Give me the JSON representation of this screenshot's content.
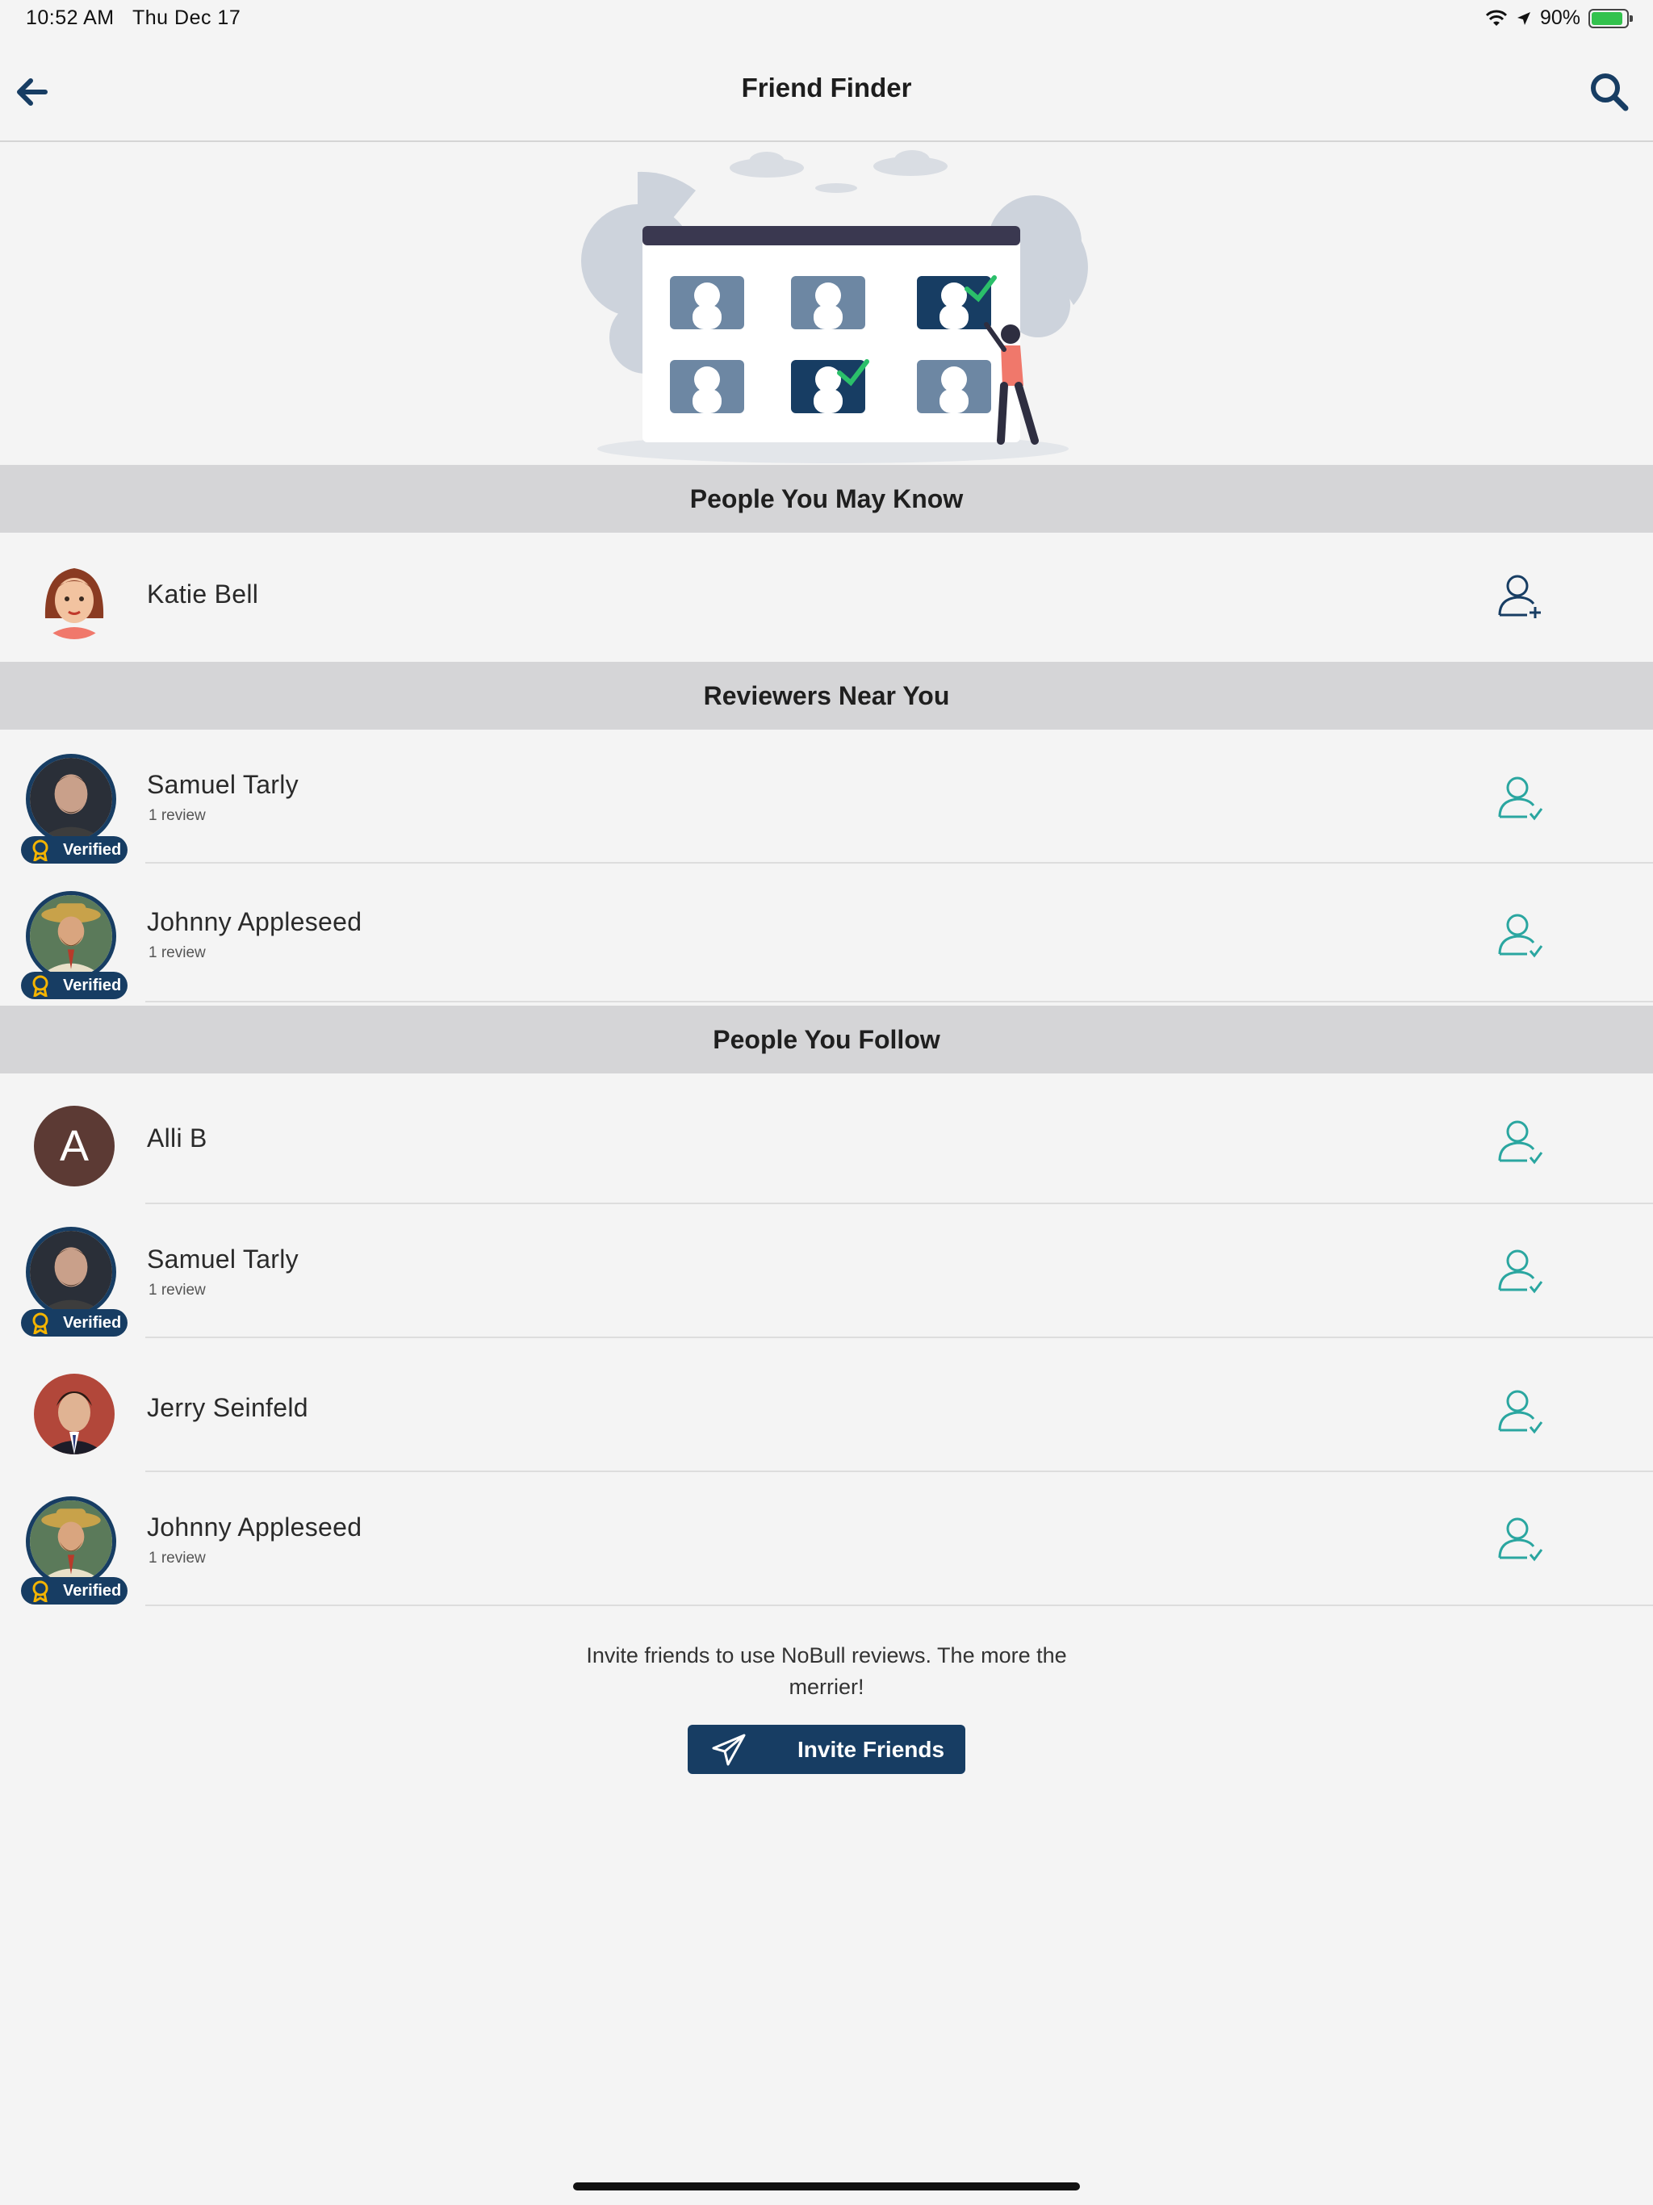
{
  "status_bar": {
    "time": "10:52 AM",
    "date": "Thu Dec 17",
    "battery": "90%",
    "battery_level": 0.9,
    "icons": [
      "wifi-icon",
      "location-arrow-icon",
      "battery-charging-icon"
    ]
  },
  "nav": {
    "title": "Friend Finder",
    "back_icon": "arrow-left-icon",
    "search_icon": "search-icon"
  },
  "sections": {
    "may_know": "People You May Know",
    "near_you": "Reviewers Near You",
    "follow": "People You Follow"
  },
  "people_may_know": [
    {
      "name": "Katie Bell",
      "avatar": "cartoon-woman-avatar",
      "action": "add-friend-icon"
    }
  ],
  "reviewers_near": [
    {
      "name": "Samuel Tarly",
      "sub": "1 review",
      "badge": "Verified",
      "action": "following-check-icon"
    },
    {
      "name": "Johnny Appleseed",
      "sub": "1 review",
      "badge": "Verified",
      "action": "following-check-icon"
    }
  ],
  "people_follow": [
    {
      "name": "Alli B",
      "initial": "A",
      "action": "following-check-icon"
    },
    {
      "name": "Samuel Tarly",
      "sub": "1 review",
      "badge": "Verified",
      "action": "following-check-icon"
    },
    {
      "name": "Jerry Seinfeld",
      "action": "following-check-icon"
    },
    {
      "name": "Johnny Appleseed",
      "sub": "1 review",
      "badge": "Verified",
      "action": "following-check-icon"
    }
  ],
  "invite": {
    "text": "Invite friends to use NoBull reviews. The more the merrier!",
    "button": "Invite Friends",
    "icon": "paper-plane-icon"
  },
  "colors": {
    "navy": "#173d63",
    "teal": "#2aa6a0",
    "section_bg": "#d5d5d7",
    "page_bg": "#f4f4f4",
    "verified_gold": "#f4b400"
  }
}
